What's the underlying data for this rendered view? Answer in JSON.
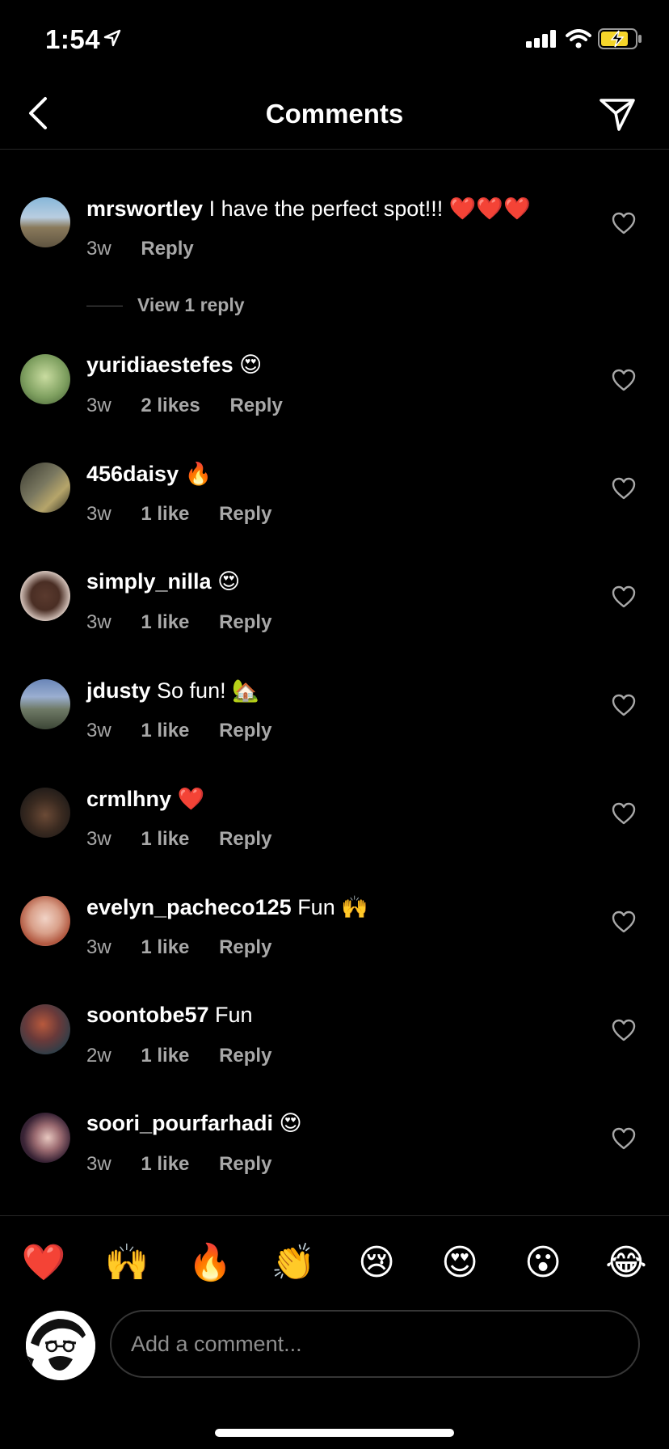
{
  "status_bar": {
    "time": "1:54"
  },
  "header": {
    "title": "Comments"
  },
  "comments": [
    {
      "username": "mrswortley",
      "text": "I have the perfect spot!!!",
      "emoji": "❤️❤️❤️",
      "age": "3w",
      "likes": "",
      "reply": "Reply"
    },
    {
      "username": "yuridiaestefes",
      "text": "",
      "emoji": "😍",
      "age": "3w",
      "likes": "2 likes",
      "reply": "Reply"
    },
    {
      "username": "456daisy",
      "text": "",
      "emoji": "🔥",
      "age": "3w",
      "likes": "1 like",
      "reply": "Reply"
    },
    {
      "username": "simply_nilla",
      "text": "",
      "emoji": "😍",
      "age": "3w",
      "likes": "1 like",
      "reply": "Reply"
    },
    {
      "username": "jdusty",
      "text": "So fun!",
      "emoji": "🏡",
      "age": "3w",
      "likes": "1 like",
      "reply": "Reply"
    },
    {
      "username": "crmlhny",
      "text": "",
      "emoji": "❤️",
      "age": "3w",
      "likes": "1 like",
      "reply": "Reply"
    },
    {
      "username": "evelyn_pacheco125",
      "text": "Fun",
      "emoji": "🙌",
      "age": "3w",
      "likes": "1 like",
      "reply": "Reply"
    },
    {
      "username": "soontobe57",
      "text": "Fun",
      "emoji": "",
      "age": "2w",
      "likes": "1 like",
      "reply": "Reply"
    },
    {
      "username": "soori_pourfarhadi",
      "text": "",
      "emoji": "😍",
      "age": "3w",
      "likes": "1 like",
      "reply": "Reply"
    }
  ],
  "view_replies": "View 1 reply",
  "emoji_bar": [
    "❤️",
    "🙌",
    "🔥",
    "👏",
    "😢",
    "😍",
    "😮",
    "😂"
  ],
  "composer": {
    "placeholder": "Add a comment..."
  },
  "colors": {
    "background": "#000000",
    "secondary_text": "#a8a8a8",
    "divider": "#262626",
    "battery": "#f5d52a"
  }
}
